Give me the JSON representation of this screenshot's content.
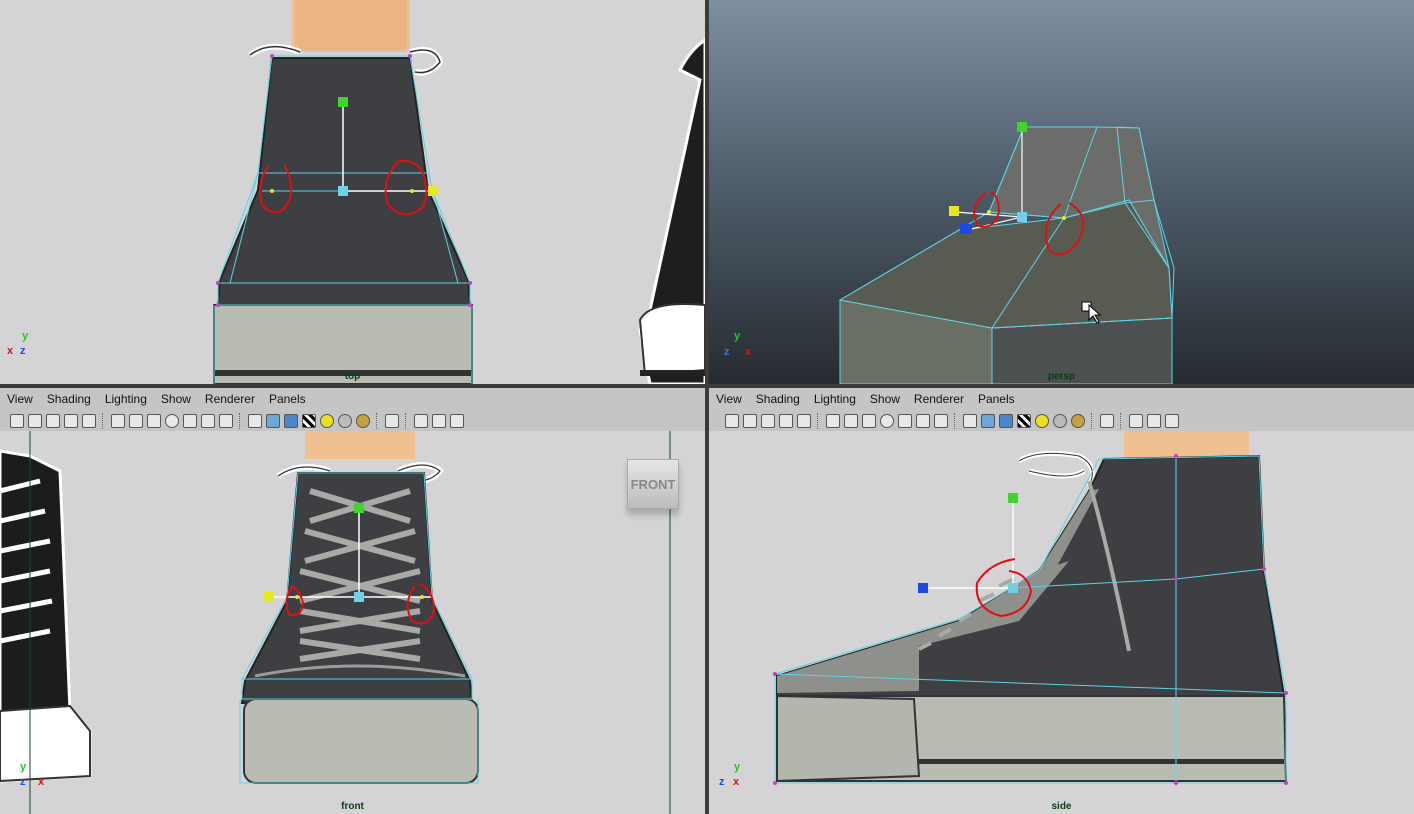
{
  "viewports": {
    "top": {
      "label": "top"
    },
    "persp": {
      "label": "persp"
    },
    "front": {
      "label": "front",
      "view_cube": "FRONT"
    },
    "side": {
      "label": "side"
    }
  },
  "menus": {
    "left": [
      "View",
      "Shading",
      "Lighting",
      "Show",
      "Renderer",
      "Panels"
    ],
    "right": [
      "View",
      "Shading",
      "Lighting",
      "Show",
      "Renderer",
      "Panels"
    ]
  },
  "axes": {
    "top": {
      "y": "y",
      "z": "z",
      "x": "x"
    },
    "persp": {
      "y": "y",
      "z": "z",
      "x": "x"
    },
    "front": {
      "y": "y",
      "z": "z",
      "x": "x"
    },
    "side": {
      "y": "y",
      "z": "z",
      "x": "x"
    }
  },
  "colors": {
    "wireframe": "#5fd3e8",
    "annotation": "#e01010",
    "manip_y": "#3fd62a",
    "manip_x": "#1f4ae0",
    "manip_center": "#6fd0e8",
    "vertex": "#e8e820"
  }
}
